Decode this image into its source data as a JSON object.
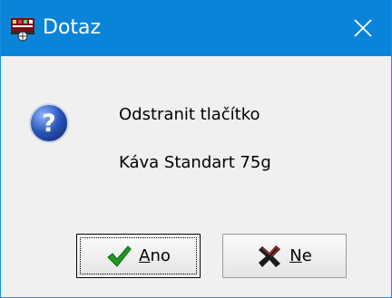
{
  "window": {
    "title": "Dotaz"
  },
  "message": {
    "line1": "Odstranit tlačítko",
    "line2": "Káva Standart 75g"
  },
  "buttons": {
    "yes": {
      "mnemonic": "A",
      "rest": "no"
    },
    "no": {
      "mnemonic": "N",
      "rest": "e"
    }
  },
  "icons": {
    "app": "app-icon",
    "close": "close-icon",
    "message": "question-icon",
    "yes": "checkmark-icon",
    "no": "cross-icon"
  },
  "colors": {
    "titlebar": "#0a84d8",
    "dialog_bg": "#f0f0f0",
    "check_green": "#1f9a1f",
    "cross_dark": "#1a1a1a",
    "question_blue": "#2a55b8"
  }
}
